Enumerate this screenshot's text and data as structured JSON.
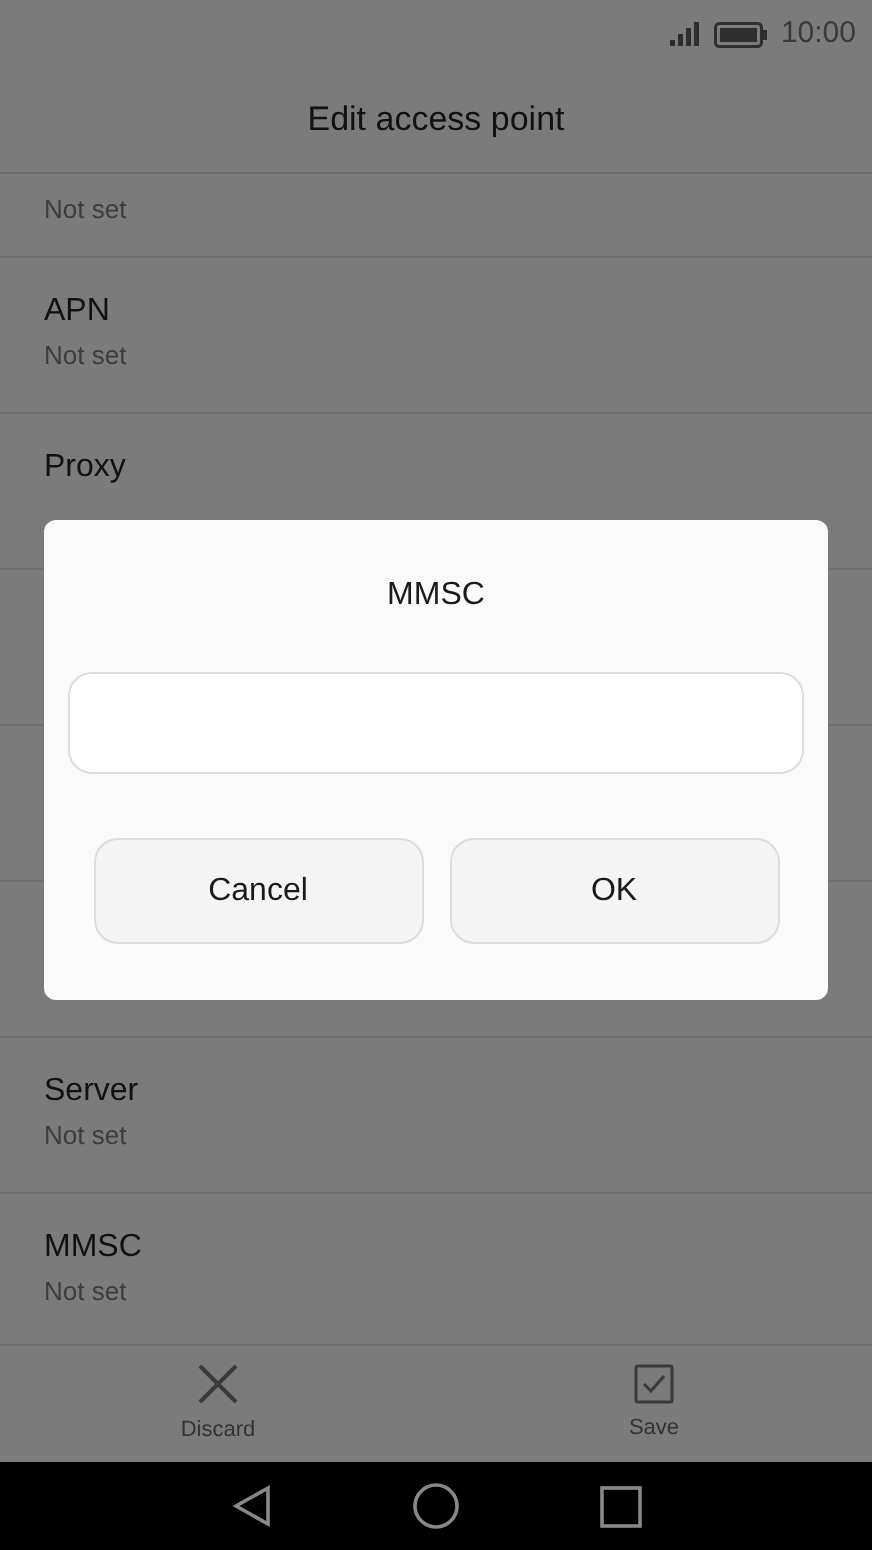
{
  "status_bar": {
    "time": "10:00"
  },
  "header": {
    "title": "Edit access point"
  },
  "rows": [
    {
      "value": "Not set"
    },
    {
      "label": "APN",
      "value": "Not set"
    },
    {
      "label": "Proxy"
    },
    {},
    {},
    {},
    {
      "label": "Server",
      "value": "Not set"
    },
    {
      "label": "MMSC",
      "value": "Not set"
    }
  ],
  "dialog": {
    "title": "MMSC",
    "buttons": [
      {
        "label": "Cancel"
      },
      {
        "label": "OK"
      }
    ]
  },
  "bottom_bar": [
    {
      "kind": "discard",
      "label": "Discard"
    },
    {
      "kind": "save",
      "label": "Save"
    }
  ]
}
